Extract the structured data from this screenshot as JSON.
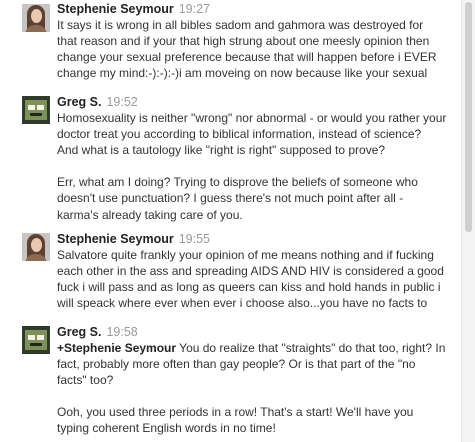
{
  "comments": [
    {
      "author": "Stephenie Seymour",
      "time": "19:27",
      "text": "It says it is wrong in all bibles sadom and gahmora was destroyed for\nthat reason and if your that high strung about one meesly opinion then\nchange your sexual preference because that will happen before i EVER\nchange my mind:-):-):-)i am moveing on now because like your sexual"
    },
    {
      "author": "Greg S.",
      "time": "19:52",
      "text": "Homosexuality is neither \"wrong\" nor abnormal - or would you rather your\ndoctor treat you according to biblical information, instead of science?\nAnd what is a tautology like \"right is right\" supposed to prove?\n\nErr, what am I doing?  Trying to disprove the beliefs of someone who\ndoesn't use punctuation?  I guess there's not much point after all -\nkarma's already taking care of you."
    },
    {
      "author": "Stephenie Seymour",
      "time": "19:55",
      "text": "Salvatore quite frankly your opinion of me means nothing and if fucking\neach other in the ass and spreading AIDS AND HIV is considered a good\nfuck i will pass and as long as queers can kiss and hold hands in public i\nwill speack where ever when ever i choose also...you have no facts to"
    },
    {
      "author": "Greg S.",
      "time": "19:58",
      "mention": "+Stephenie Seymour",
      "text": " You do realize that \"straights\" do that too, right?  In\nfact, probably more often than gay people?  Or is that part of the \"no\nfacts\" too?\n\nOoh, you used three periods in a row!  That's a start!  We'll have you\ntyping coherent English words in no time!"
    }
  ]
}
